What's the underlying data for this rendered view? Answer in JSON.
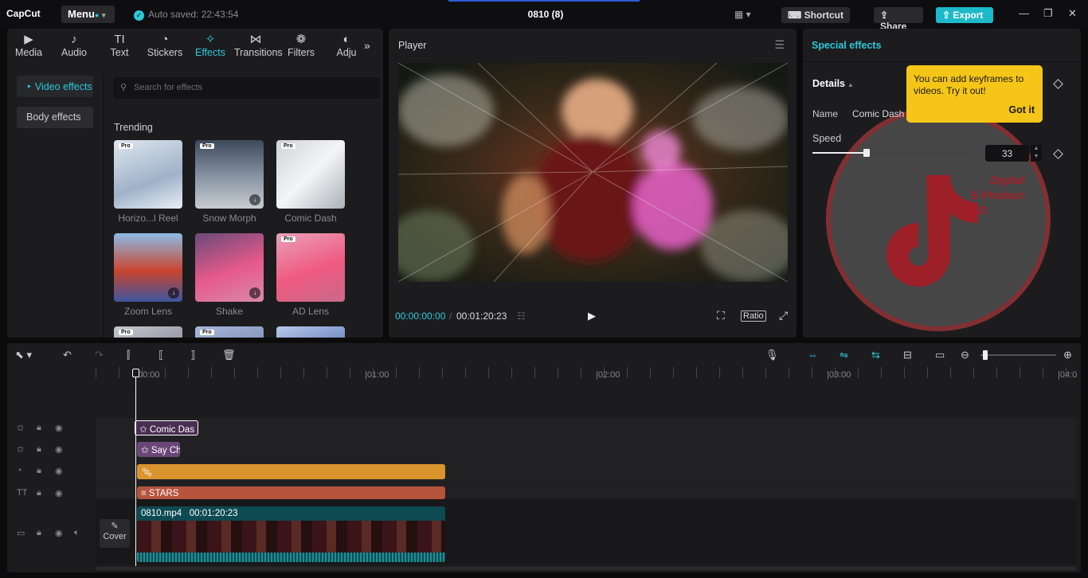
{
  "app": {
    "logo": "CapCut",
    "menu_label": "Menu",
    "autosave": "Auto saved: 22:43:54",
    "project_title": "0810 (8)",
    "shortcut_label": "Shortcut",
    "share_label": "Share",
    "export_label": "Export",
    "accent": "#2cc9d9"
  },
  "library": {
    "tabs": [
      {
        "label": "Media",
        "icon": "media-icon"
      },
      {
        "label": "Audio",
        "icon": "audio-icon"
      },
      {
        "label": "Text",
        "icon": "text-icon"
      },
      {
        "label": "Stickers",
        "icon": "stickers-icon"
      },
      {
        "label": "Effects",
        "icon": "effects-icon"
      },
      {
        "label": "Transitions",
        "icon": "transitions-icon"
      },
      {
        "label": "Filters",
        "icon": "filters-icon"
      },
      {
        "label": "Adju",
        "icon": "adjust-icon"
      }
    ],
    "active_tab": "Effects",
    "categories": [
      "Video effects",
      "Body effects"
    ],
    "search_placeholder": "Search for effects",
    "section_title": "Trending",
    "effects": [
      {
        "label": "Horizo...l Reel",
        "pro": "Pro",
        "download": false
      },
      {
        "label": "Snow Morph",
        "pro": "Pro",
        "download": true
      },
      {
        "label": "Comic Dash",
        "pro": "Pro",
        "download": false
      },
      {
        "label": "Zoom Lens",
        "pro": "",
        "download": true
      },
      {
        "label": "Shake",
        "pro": "",
        "download": true
      },
      {
        "label": "AD Lens",
        "pro": "Pro",
        "download": false
      },
      {
        "label": "",
        "pro": "Pro",
        "download": false
      },
      {
        "label": "",
        "pro": "Pro",
        "download": false
      },
      {
        "label": "",
        "pro": "",
        "download": false
      }
    ]
  },
  "player": {
    "title": "Player",
    "current_time": "00:00:00:00",
    "duration": "00:01:20:23",
    "ratio_label": "Ratio"
  },
  "inspector": {
    "title": "Special effects",
    "details_label": "Details",
    "name_label": "Name",
    "name_value": "Comic Dash",
    "speed_label": "Speed",
    "speed_value": "33",
    "speed_fraction": 0.33,
    "tooltip_text": "You can add keyframes to videos. Try it out!",
    "tooltip_button": "Got it",
    "watermark_lines": [
      "Digital",
      "E-Product",
      "BD"
    ]
  },
  "timeline": {
    "ruler_labels": [
      "00:00",
      "01:00",
      "02:00",
      "03:00",
      "04:0"
    ],
    "tracks": [
      {
        "kind": "effect",
        "clip_label": "Comic Das",
        "color": "#4a2d52"
      },
      {
        "kind": "effect",
        "clip_label": "Say Ch",
        "color": "#6b4678"
      },
      {
        "kind": "sticker",
        "clip_label": "",
        "color": "#d9942e"
      },
      {
        "kind": "text",
        "clip_label": "STARS",
        "color": "#b5533d"
      }
    ],
    "main_clip": {
      "filename": "0810.mp4",
      "duration": "00:01:20:23"
    },
    "cover_label": "Cover"
  }
}
